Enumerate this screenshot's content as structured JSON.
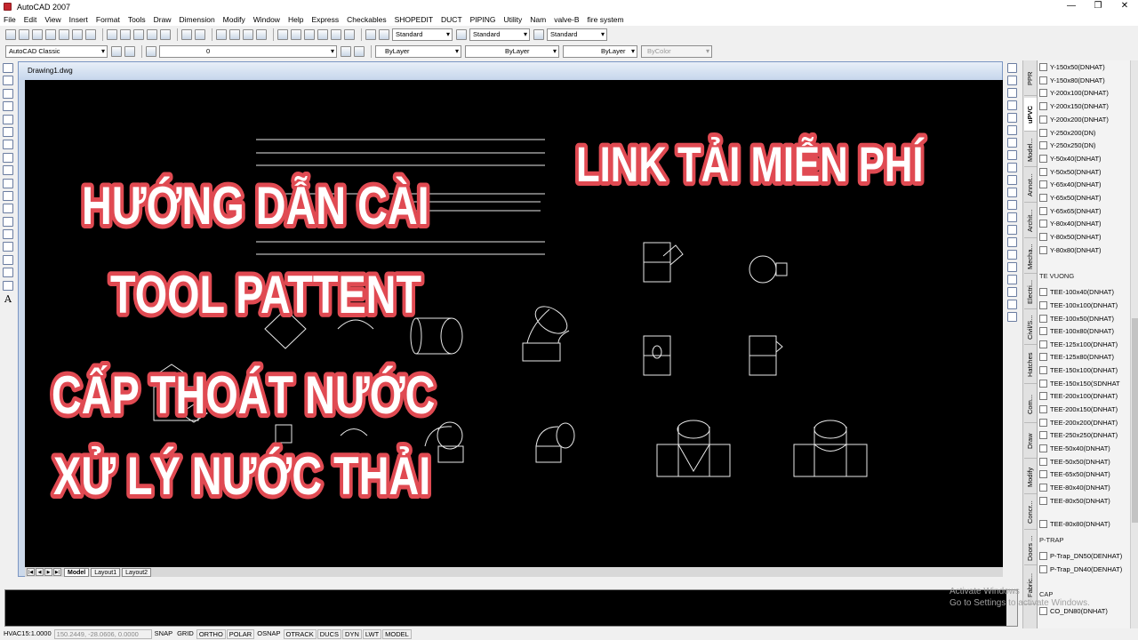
{
  "app": {
    "title": "AutoCAD 2007"
  },
  "menu": [
    "File",
    "Edit",
    "View",
    "Insert",
    "Format",
    "Tools",
    "Draw",
    "Dimension",
    "Modify",
    "Window",
    "Help",
    "Express",
    "Checkables",
    "SHOPEDIT",
    "DUCT",
    "PIPING",
    "Utility",
    "Nam",
    "valve-B",
    "fire system"
  ],
  "toolbar1": {
    "text_style": "Standard",
    "dim_style": "Standard",
    "table_style": "Standard"
  },
  "toolbar2": {
    "workspace": "AutoCAD Classic",
    "layer": "0",
    "color": "ByLayer",
    "linetype": "ByLayer",
    "lineweight": "ByLayer",
    "plotstyle": "ByColor"
  },
  "left_toolbar": {
    "text_tool": "A"
  },
  "drawing": {
    "filename": "Drawing1.dwg"
  },
  "overlay": {
    "left_lines": [
      "HƯỚNG DẪN CÀI",
      "TOOL PATTENT",
      "CẤP THOÁT NƯỚC",
      "XỬ LÝ NƯỚC THẢI"
    ],
    "right_title": "LINK TẢI MIỄN PHÍ",
    "fill_color": "#ffffff",
    "outline_color": "#e04a52"
  },
  "layout_tabs": [
    "Model",
    "Layout1",
    "Layout2"
  ],
  "palette_tabs": [
    "PPR",
    "uPVC",
    "Model...",
    "Annot...",
    "Archit...",
    "Mecha...",
    "Electri...",
    "Civil/S...",
    "Hatches",
    "Com...",
    "Draw",
    "Modify",
    "Concr...",
    "Doors ...",
    "Fabric..."
  ],
  "palette_items": [
    {
      "label": "Y-150x50(DNHAT)",
      "header": false
    },
    {
      "label": "Y-150x80(DNHAT)",
      "header": false
    },
    {
      "label": "Y-200x100(DNHAT)",
      "header": false
    },
    {
      "label": "Y-200x150(DNHAT)",
      "header": false
    },
    {
      "label": "Y-200x200(DNHAT)",
      "header": false
    },
    {
      "label": "Y-250x200(DN)",
      "header": false
    },
    {
      "label": "Y-250x250(DN)",
      "header": false
    },
    {
      "label": "Y-50x40(DNHAT)",
      "header": false
    },
    {
      "label": "Y-50x50(DNHAT)",
      "header": false
    },
    {
      "label": "Y-65x40(DNHAT)",
      "header": false
    },
    {
      "label": "Y-65x50(DNHAT)",
      "header": false
    },
    {
      "label": "Y-65x65(DNHAT)",
      "header": false
    },
    {
      "label": "Y-80x40(DNHAT)",
      "header": false
    },
    {
      "label": "Y-80x50(DNHAT)",
      "header": false
    },
    {
      "label": "Y-80x80(DNHAT)",
      "header": false
    },
    {
      "label": "TE VUONG",
      "header": true
    },
    {
      "label": "TEE-100x40(DNHAT)",
      "header": false
    },
    {
      "label": "TEE-100x100(DNHAT)",
      "header": false
    },
    {
      "label": "TEE-100x50(DNHAT)",
      "header": false
    },
    {
      "label": "TEE-100x80(DNHAT)",
      "header": false
    },
    {
      "label": "TEE-125x100(DNHAT)",
      "header": false
    },
    {
      "label": "TEE-125x80(DNHAT)",
      "header": false
    },
    {
      "label": "TEE-150x100(DNHAT)",
      "header": false
    },
    {
      "label": "TEE-150x150(SDNHAT",
      "header": false
    },
    {
      "label": "TEE-200x100(DNHAT)",
      "header": false
    },
    {
      "label": "TEE-200x150(DNHAT)",
      "header": false
    },
    {
      "label": "TEE-200x200(DNHAT)",
      "header": false
    },
    {
      "label": "TEE-250x250(DNHAT)",
      "header": false
    },
    {
      "label": "TEE-50x40(DNHAT)",
      "header": false
    },
    {
      "label": "TEE-50x50(DNHAT)",
      "header": false
    },
    {
      "label": "TEE-65x50(DNHAT)",
      "header": false
    },
    {
      "label": "TEE-80x40(DNHAT)",
      "header": false
    },
    {
      "label": "TEE-80x50(DNHAT)",
      "header": false
    },
    {
      "label": "TEE-80x80(DNHAT)",
      "header": false
    },
    {
      "label": "P-TRAP",
      "header": true
    },
    {
      "label": "P-Trap_DN50(DENHAT)",
      "header": false
    },
    {
      "label": "P-Trap_DN40(DENHAT)",
      "header": false
    },
    {
      "label": "CAP",
      "header": true
    },
    {
      "label": "CO_DN80(DNHAT)",
      "header": false
    }
  ],
  "watermark": {
    "line1": "Activate Windows",
    "line2": "Go to Settings to activate Windows."
  },
  "status": {
    "scale": "HVAC15:1.0000",
    "coords": "150.2449, -28.0606, 0.0000",
    "toggles": [
      "SNAP",
      "GRID",
      "ORTHO",
      "POLAR",
      "OSNAP",
      "OTRACK",
      "DUCS",
      "DYN",
      "LWT",
      "MODEL"
    ]
  }
}
